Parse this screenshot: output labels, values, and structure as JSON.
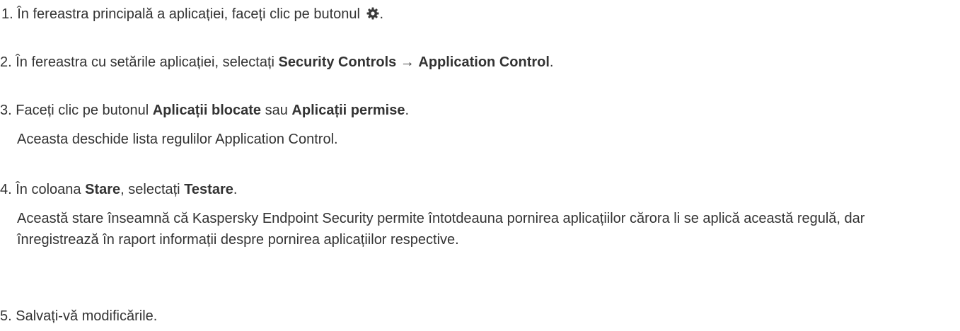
{
  "steps": [
    {
      "number": "1.",
      "text_before_icon": "În fereastra principală a aplicației, faceți clic pe butonul",
      "icon": "gear-icon",
      "text_after_icon": "."
    },
    {
      "number": "2.",
      "text_before": "În fereastra cu setările aplicației, selectați ",
      "bold_1": "Security Controls",
      "arrow": " → ",
      "bold_2": "Application Control",
      "text_after": "."
    },
    {
      "number": "3.",
      "text_before": "Faceți clic pe butonul ",
      "bold_1": "Aplicații blocate",
      "middle": " sau ",
      "bold_2": "Aplicații permise",
      "text_after": ".",
      "note": "Aceasta deschide lista regulilor Application Control."
    },
    {
      "number": "4.",
      "text_before": "În coloana ",
      "bold_1": "Stare",
      "middle": ", selectați ",
      "bold_2": "Testare",
      "text_after": ".",
      "note": "Această stare înseamnă că Kaspersky Endpoint Security permite întotdeauna pornirea aplicațiilor cărora li se aplică această regulă, dar înregistrează în raport informații despre pornirea aplicațiilor respective."
    },
    {
      "number": "5.",
      "text": "Salvați-vă modificările."
    }
  ],
  "colors": {
    "text": "#333333",
    "background": "#ffffff"
  }
}
